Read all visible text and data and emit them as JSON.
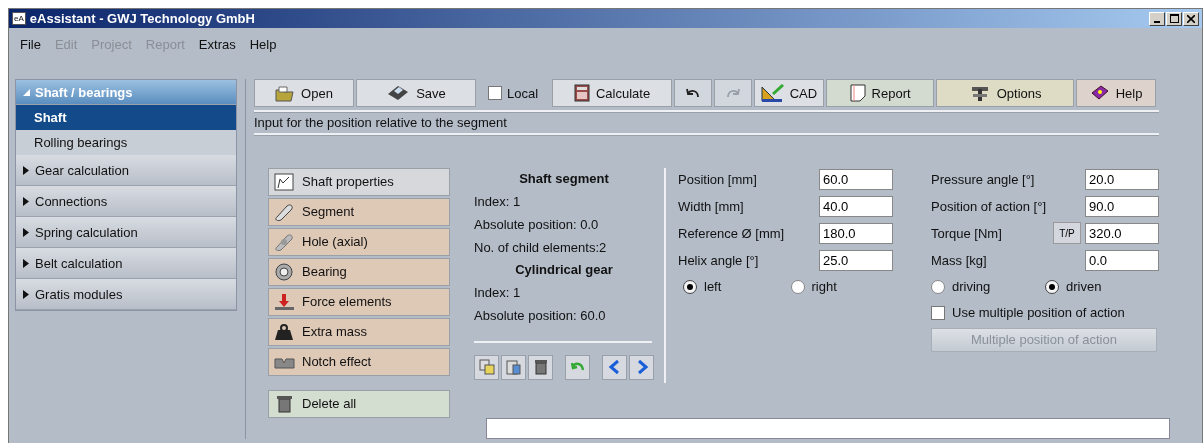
{
  "window": {
    "title": "eAssistant - GWJ Technology GmbH",
    "app_icon": "eA"
  },
  "menu": [
    {
      "label": "File",
      "disabled": false
    },
    {
      "label": "Edit",
      "disabled": true
    },
    {
      "label": "Project",
      "disabled": true
    },
    {
      "label": "Report",
      "disabled": true
    },
    {
      "label": "Extras",
      "disabled": false
    },
    {
      "label": "Help",
      "disabled": false
    }
  ],
  "sidebar": [
    {
      "label": "Shaft / bearings",
      "expanded": true,
      "children": [
        {
          "label": "Shaft",
          "selected": true
        },
        {
          "label": "Rolling bearings",
          "selected": false
        }
      ]
    },
    {
      "label": "Gear calculation",
      "expanded": false
    },
    {
      "label": "Connections",
      "expanded": false
    },
    {
      "label": "Spring calculation",
      "expanded": false
    },
    {
      "label": "Belt calculation",
      "expanded": false
    },
    {
      "label": "Gratis modules",
      "expanded": false
    }
  ],
  "toolbar": [
    {
      "kind": "button",
      "label": "Open",
      "color": "#dcdfe4",
      "disabled": false
    },
    {
      "kind": "button",
      "label": "Save",
      "color": "#dcdfe4",
      "disabled": false
    },
    {
      "kind": "checkbox",
      "label": "Local",
      "checked": false
    },
    {
      "kind": "button",
      "label": "Calculate",
      "color": "#dcdfe4",
      "disabled": false
    },
    {
      "kind": "icon",
      "disabled": false
    },
    {
      "kind": "icon",
      "disabled": true
    },
    {
      "kind": "button",
      "label": "CAD",
      "color": "#dcdfe4",
      "disabled": false
    },
    {
      "kind": "button",
      "label": "Report",
      "color": "#d3dbd0",
      "disabled": false
    },
    {
      "kind": "button",
      "label": "Options",
      "color": "#dedcc4",
      "disabled": false
    },
    {
      "kind": "button",
      "label": "Help",
      "color": "#ddd2cc",
      "disabled": false
    }
  ],
  "hint": "Input for the position relative to the segment",
  "elements": [
    {
      "label": "Shaft properties",
      "color": "#d6d8dc"
    },
    {
      "label": "Segment",
      "color": "#dec8b6"
    },
    {
      "label": "Hole (axial)",
      "color": "#dec8b6"
    },
    {
      "label": "Bearing",
      "color": "#dec8b6"
    },
    {
      "label": "Force elements",
      "color": "#dec8b6"
    },
    {
      "label": "Extra mass",
      "color": "#dec8b6"
    },
    {
      "label": "Notch effect",
      "color": "#dec8b6"
    }
  ],
  "delete_all": {
    "label": "Delete all",
    "color": "#d4ded0"
  },
  "info": [
    {
      "kind": "heading",
      "text": "Shaft segment"
    },
    {
      "kind": "line",
      "text": "Index: 1"
    },
    {
      "kind": "line",
      "text": "Absolute position:   0.0"
    },
    {
      "kind": "line",
      "text": "No. of child elements:2"
    },
    {
      "kind": "heading",
      "text": "Cylindrical gear"
    },
    {
      "kind": "line",
      "text": "Index: 1"
    },
    {
      "kind": "line",
      "text": "Absolute position:   60.0"
    }
  ],
  "fields_left": [
    {
      "label": "Position [mm]",
      "value": "60.0"
    },
    {
      "label": "Width [mm]",
      "value": "40.0"
    },
    {
      "label": "Reference Ø [mm]",
      "value": "180.0"
    },
    {
      "label": "Helix angle [°]",
      "value": "25.0"
    }
  ],
  "fields_right": [
    {
      "label": "Pressure angle [°]",
      "value": "20.0"
    },
    {
      "label": "Position of action [°]",
      "value": "90.0"
    },
    {
      "label": "Torque [Nm]",
      "value": "320.0",
      "button": "T/P"
    },
    {
      "label": "Mass [kg]",
      "value": "0.0"
    }
  ],
  "helix_direction": [
    {
      "label": "left",
      "selected": true
    },
    {
      "label": "right",
      "selected": false
    }
  ],
  "drive": [
    {
      "label": "driving",
      "selected": false
    },
    {
      "label": "driven",
      "selected": true
    }
  ],
  "multiple_checkbox": {
    "label": "Use multiple position of action",
    "checked": false
  },
  "multiple_button": {
    "label": "Multiple position of action",
    "disabled": true
  }
}
